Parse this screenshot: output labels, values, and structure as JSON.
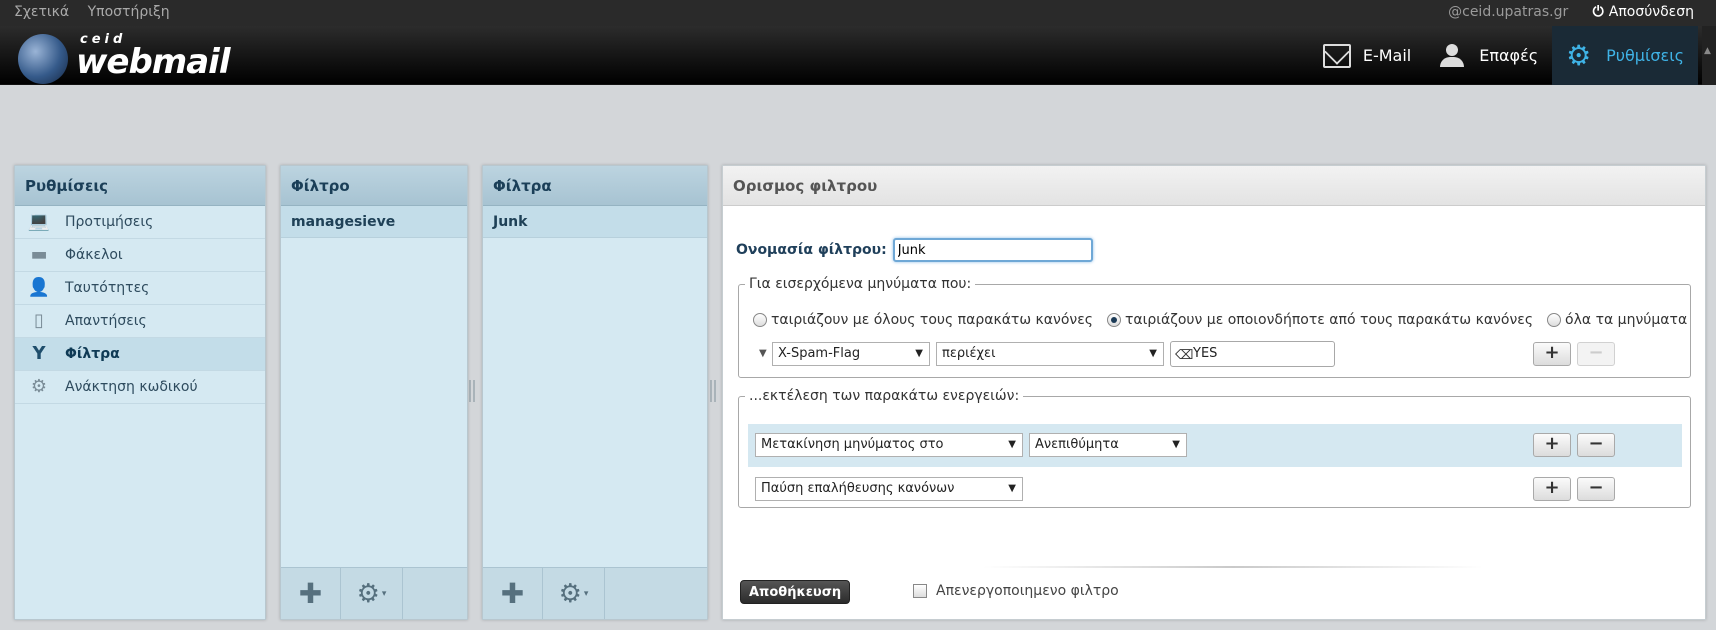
{
  "topbar": {
    "links": [
      "Σχετικά",
      "Υποστήριξη"
    ],
    "user": "@ceid.upatras.gr",
    "logout": "Αποσύνδεση"
  },
  "logo": {
    "ceid": "ceid",
    "webmail": "webmail"
  },
  "nav": [
    {
      "label": "E-Mail",
      "icon": "mail-icon"
    },
    {
      "label": "Επαφές",
      "icon": "contacts-icon"
    },
    {
      "label": "Ρυθμίσεις",
      "icon": "gear-icon",
      "active": true
    }
  ],
  "settings_panel": {
    "title": "Ρυθμίσεις",
    "items": [
      {
        "label": "Προτιμήσεις",
        "icon": "laptop-icon"
      },
      {
        "label": "Φάκελοι",
        "icon": "folder-icon"
      },
      {
        "label": "Ταυτότητες",
        "icon": "identity-icon"
      },
      {
        "label": "Απαντήσεις",
        "icon": "document-icon"
      },
      {
        "label": "Φίλτρα",
        "icon": "filter-icon",
        "selected": true
      },
      {
        "label": "Ανάκτηση κωδικού",
        "icon": "gear-icon"
      }
    ]
  },
  "filter_sets_panel": {
    "title": "Φίλτρο",
    "items": [
      "managesieve"
    ]
  },
  "filters_panel": {
    "title": "Φίλτρα",
    "items": [
      "Junk"
    ]
  },
  "definition": {
    "title": "Ορισμος φιλτρου",
    "name_label": "Ονομασία φίλτρου:",
    "name_value": "Junk",
    "incoming_legend": "Για εισερχόμενα μηνύματα που:",
    "radio_all": "ταιριάζουν με όλους τους παρακάτω κανόνες",
    "radio_any": "ταιριάζουν με οποιονδήποτε από τους παρακάτω κανόνες",
    "radio_every": "όλα τα μηνύματα",
    "rule": {
      "header": "X-Spam-Flag",
      "operator": "περιέχει",
      "value": "YES"
    },
    "actions_legend": "...εκτέλεση των παρακάτω ενεργειών:",
    "action1": {
      "type": "Μετακίνηση μηνύματος στο",
      "target": "Ανεπιθύμητα"
    },
    "action2": {
      "type": "Παύση επαλήθευσης κανόνων"
    },
    "plus": "+",
    "minus": "−",
    "save": "Αποθήκευση",
    "disabled_label": "Απενεργοποιημενο φιλτρο"
  },
  "colors": {
    "accent": "#3fb3e6",
    "panel": "#d5e9f2",
    "header": "#000000"
  }
}
